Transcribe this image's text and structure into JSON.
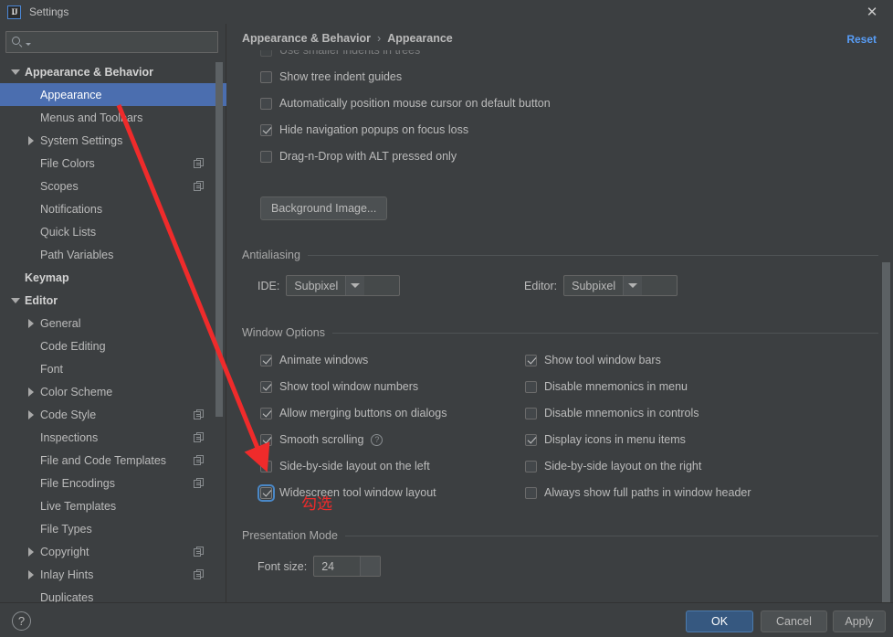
{
  "window": {
    "title": "Settings",
    "logo_text": "IJ",
    "close_label": "✕"
  },
  "search": {
    "value": "",
    "placeholder": ""
  },
  "sidebar": {
    "items": [
      {
        "label": "Appearance & Behavior",
        "level": 0,
        "twisty": "down",
        "selected": false,
        "group": true,
        "dup": false
      },
      {
        "label": "Appearance",
        "level": 1,
        "twisty": "none",
        "selected": true,
        "group": false,
        "dup": false
      },
      {
        "label": "Menus and Toolbars",
        "level": 1,
        "twisty": "none",
        "selected": false,
        "group": false,
        "dup": false
      },
      {
        "label": "System Settings",
        "level": 1,
        "twisty": "right",
        "selected": false,
        "group": false,
        "dup": false
      },
      {
        "label": "File Colors",
        "level": 1,
        "twisty": "none",
        "selected": false,
        "group": false,
        "dup": true
      },
      {
        "label": "Scopes",
        "level": 1,
        "twisty": "none",
        "selected": false,
        "group": false,
        "dup": true
      },
      {
        "label": "Notifications",
        "level": 1,
        "twisty": "none",
        "selected": false,
        "group": false,
        "dup": false
      },
      {
        "label": "Quick Lists",
        "level": 1,
        "twisty": "none",
        "selected": false,
        "group": false,
        "dup": false
      },
      {
        "label": "Path Variables",
        "level": 1,
        "twisty": "none",
        "selected": false,
        "group": false,
        "dup": false
      },
      {
        "label": "Keymap",
        "level": 0,
        "twisty": "none",
        "selected": false,
        "group": true,
        "dup": false
      },
      {
        "label": "Editor",
        "level": 0,
        "twisty": "down",
        "selected": false,
        "group": true,
        "dup": false
      },
      {
        "label": "General",
        "level": 1,
        "twisty": "right",
        "selected": false,
        "group": false,
        "dup": false
      },
      {
        "label": "Code Editing",
        "level": 1,
        "twisty": "none",
        "selected": false,
        "group": false,
        "dup": false
      },
      {
        "label": "Font",
        "level": 1,
        "twisty": "none",
        "selected": false,
        "group": false,
        "dup": false
      },
      {
        "label": "Color Scheme",
        "level": 1,
        "twisty": "right",
        "selected": false,
        "group": false,
        "dup": false
      },
      {
        "label": "Code Style",
        "level": 1,
        "twisty": "right",
        "selected": false,
        "group": false,
        "dup": true
      },
      {
        "label": "Inspections",
        "level": 1,
        "twisty": "none",
        "selected": false,
        "group": false,
        "dup": true
      },
      {
        "label": "File and Code Templates",
        "level": 1,
        "twisty": "none",
        "selected": false,
        "group": false,
        "dup": true
      },
      {
        "label": "File Encodings",
        "level": 1,
        "twisty": "none",
        "selected": false,
        "group": false,
        "dup": true
      },
      {
        "label": "Live Templates",
        "level": 1,
        "twisty": "none",
        "selected": false,
        "group": false,
        "dup": false
      },
      {
        "label": "File Types",
        "level": 1,
        "twisty": "none",
        "selected": false,
        "group": false,
        "dup": false
      },
      {
        "label": "Copyright",
        "level": 1,
        "twisty": "right",
        "selected": false,
        "group": false,
        "dup": true
      },
      {
        "label": "Inlay Hints",
        "level": 1,
        "twisty": "right",
        "selected": false,
        "group": false,
        "dup": true
      },
      {
        "label": "Duplicates",
        "level": 1,
        "twisty": "none",
        "selected": false,
        "group": false,
        "dup": false
      }
    ]
  },
  "content": {
    "breadcrumb": {
      "parent": "Appearance & Behavior",
      "separator": "›",
      "current": "Appearance"
    },
    "reset_label": "Reset",
    "top_options": [
      {
        "label": "Use smaller indents in trees",
        "checked": false
      },
      {
        "label": "Show tree indent guides",
        "checked": false
      },
      {
        "label": "Automatically position mouse cursor on default button",
        "checked": false
      },
      {
        "label": "Hide navigation popups on focus loss",
        "checked": true
      },
      {
        "label": "Drag-n-Drop with ALT pressed only",
        "checked": false
      }
    ],
    "background_image_button": "Background Image...",
    "antialiasing": {
      "section_title": "Antialiasing",
      "ide_label": "IDE:",
      "ide_value": "Subpixel",
      "editor_label": "Editor:",
      "editor_value": "Subpixel"
    },
    "window_options": {
      "section_title": "Window Options",
      "left_column": [
        {
          "label": "Animate windows",
          "checked": true,
          "focused": false,
          "help": false
        },
        {
          "label": "Show tool window numbers",
          "checked": true,
          "focused": false,
          "help": false
        },
        {
          "label": "Allow merging buttons on dialogs",
          "checked": true,
          "focused": false,
          "help": false
        },
        {
          "label": "Smooth scrolling",
          "checked": true,
          "focused": false,
          "help": true
        },
        {
          "label": "Side-by-side layout on the left",
          "checked": false,
          "focused": false,
          "help": false
        },
        {
          "label": "Widescreen tool window layout",
          "checked": true,
          "focused": true,
          "help": false
        }
      ],
      "right_column": [
        {
          "label": "Show tool window bars",
          "checked": true,
          "focused": false,
          "help": false
        },
        {
          "label": "Disable mnemonics in menu",
          "checked": false,
          "focused": false,
          "help": false
        },
        {
          "label": "Disable mnemonics in controls",
          "checked": false,
          "focused": false,
          "help": false
        },
        {
          "label": "Display icons in menu items",
          "checked": true,
          "focused": false,
          "help": false
        },
        {
          "label": "Side-by-side layout on the right",
          "checked": false,
          "focused": false,
          "help": false
        },
        {
          "label": "Always show full paths in window header",
          "checked": false,
          "focused": false,
          "help": false
        }
      ]
    },
    "presentation_mode": {
      "section_title": "Presentation Mode",
      "font_size_label": "Font size:",
      "font_size_value": "24"
    },
    "help_char": "?"
  },
  "footer": {
    "ok_label": "OK",
    "cancel_label": "Cancel",
    "apply_label": "Apply"
  },
  "annotation": {
    "text": "勾选",
    "color": "#ef2b2b"
  },
  "colors": {
    "background": "#3c3f41",
    "selection": "#4b6eaf",
    "accent_link": "#589df6",
    "primary_button": "#365880",
    "annotation_red": "#ef2b2b"
  }
}
